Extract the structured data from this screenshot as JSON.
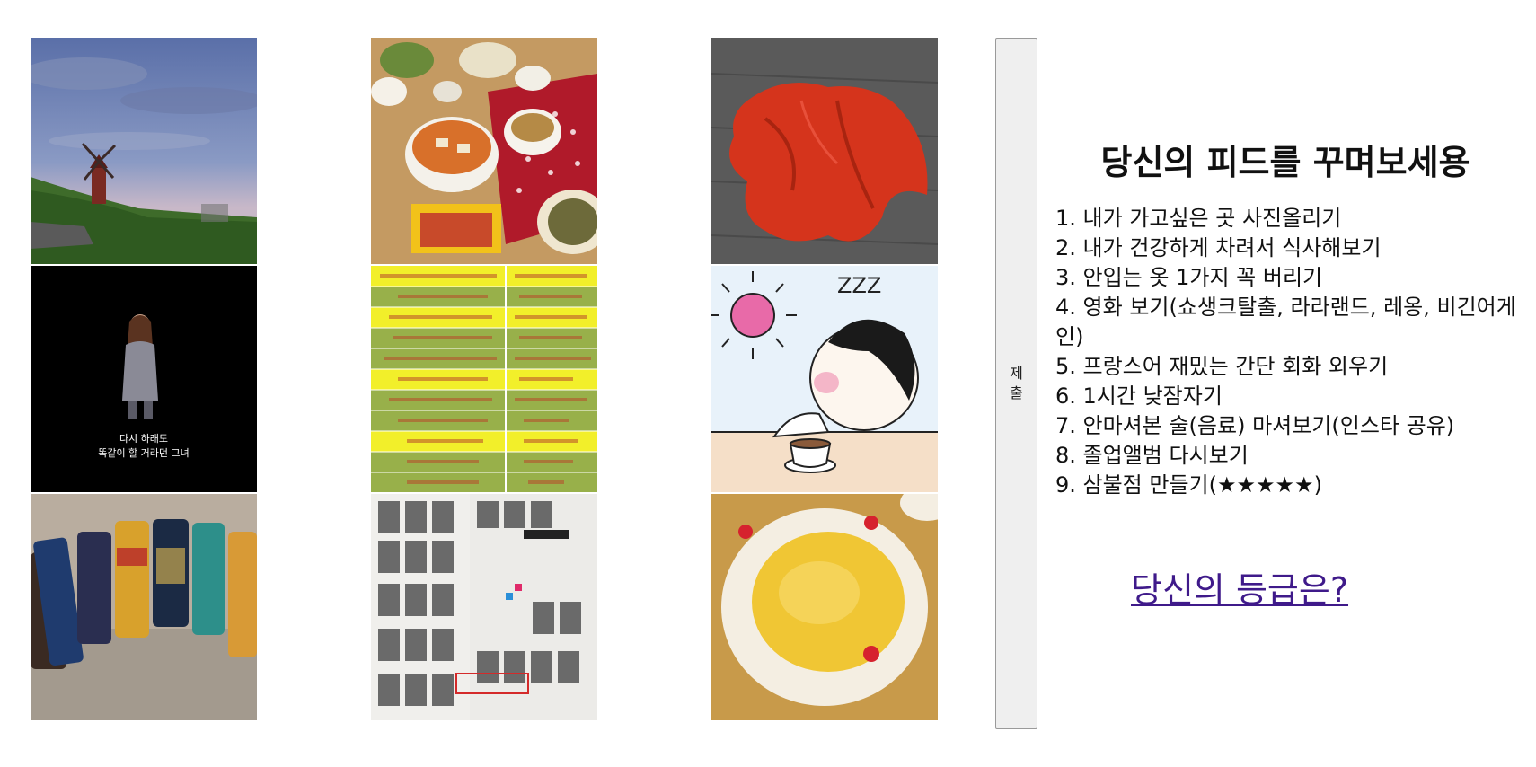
{
  "photos": [
    {
      "subject": "windmill-landscape"
    },
    {
      "subject": "korean-meal"
    },
    {
      "subject": "red-clothing"
    },
    {
      "subject": "movie-scene",
      "subtitle_line1": "다시 하래도",
      "subtitle_line2": "똑같이 할 거라던 그녀"
    },
    {
      "subject": "french-phrases"
    },
    {
      "subject": "nap-cartoon",
      "zzz": "ZZZ"
    },
    {
      "subject": "beer-cans"
    },
    {
      "subject": "graduation-album"
    },
    {
      "subject": "drink-plate"
    }
  ],
  "submit_button": {
    "label": "제출"
  },
  "panel": {
    "title": "당신의 피드를 꾸며보세용",
    "items": [
      "1. 내가 가고싶은 곳 사진올리기",
      "2. 내가 건강하게 차려서 식사해보기",
      "3. 안입는 옷 1가지 꼭 버리기",
      "4. 영화 보기(쇼생크탈출, 라라랜드, 레옹, 비긴어게인)",
      "5. 프랑스어 재밌는 간단 회화 외우기",
      "6. 1시간 낮잠자기",
      "7. 안마셔본 술(음료) 마셔보기(인스타 공유)",
      "8. 졸업앨범 다시보기",
      "9. 삼불점 만들기(★★★★★)"
    ]
  },
  "grade_link": {
    "label": "당신의 등급은?"
  }
}
